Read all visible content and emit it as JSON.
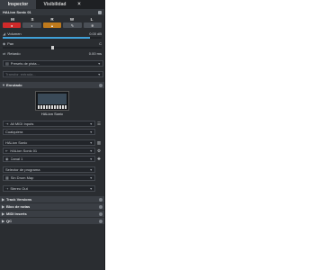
{
  "tabs": {
    "inspector": "Inspector",
    "visibility": "Visibilidad",
    "close": "×"
  },
  "track": {
    "name": "HALion Sonic 01"
  },
  "msrw": {
    "m": "M",
    "s": "S",
    "r": "R",
    "w": "W",
    "l": "L"
  },
  "volume": {
    "label": "Volumen",
    "value": "0.00 dB",
    "level": 0.88
  },
  "pan": {
    "label": "Pan",
    "value": "C",
    "position": 0.5
  },
  "delay": {
    "label": "Retardo",
    "value": "0.00 ms"
  },
  "preset": {
    "label": "Presets de pista..."
  },
  "inputtrans": {
    "label": "Transfor. entrada..."
  },
  "routing": {
    "section": "Enrutado",
    "instrument_name": "HALion Sonic",
    "input": "All MIDI Inputs",
    "channel_any": "Cualquiera",
    "output_device": "HALion Sonic",
    "output": "HALion Sonic 01",
    "midi_channel": "Canal 1",
    "program_selector": "Selector de programa",
    "drum_map": "Sin Drum Map",
    "stereo_out": "Stereo Out"
  },
  "sections": {
    "track_versions": "Track Versions",
    "notepad": "Bloc de notas",
    "midi_inserts": "MIDI Inserts",
    "qc": "QC"
  }
}
